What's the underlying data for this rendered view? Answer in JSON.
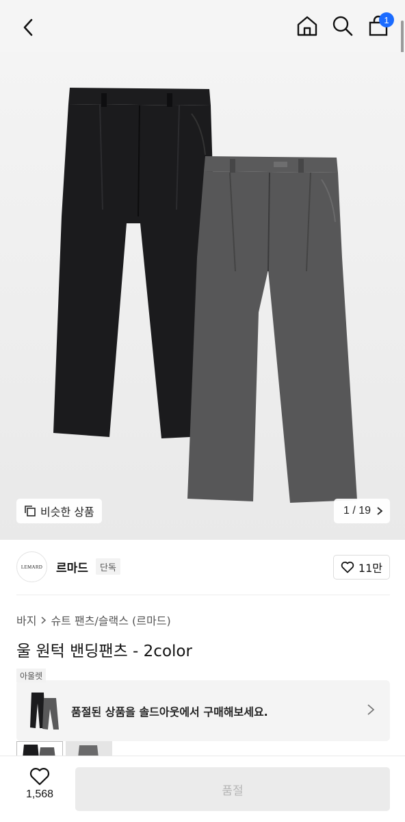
{
  "header": {
    "cart_count": "1",
    "icons": [
      "back-arrow-icon",
      "home-icon",
      "search-icon",
      "shopping-bag-icon"
    ]
  },
  "gallery": {
    "similar_label": "비슷한 상품",
    "page_indicator": "1 / 19",
    "colors": {
      "black": "#1b1b1d",
      "gray": "#555556"
    }
  },
  "brand": {
    "logo_text": "LEMARD",
    "name": "르마드",
    "tag": "단독",
    "likes": "11만"
  },
  "product": {
    "breadcrumb": [
      "바지",
      "슈트 팬츠/슬랙스 (르마드)"
    ],
    "title": "울 원턱 밴딩팬츠 - 2color"
  },
  "soldout": {
    "tag": "아울렛",
    "message": "품절된 상품을 솔드아웃에서 구매해보세요."
  },
  "bottom": {
    "wish_count": "1,568",
    "buy_label": "품절"
  },
  "colors": {
    "accent": "#1a6bff",
    "disabled_button": "#ebebeb"
  }
}
